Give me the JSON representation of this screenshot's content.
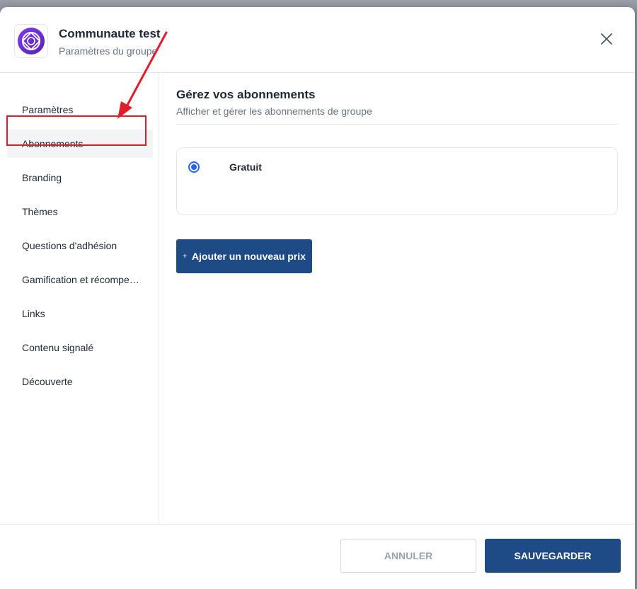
{
  "header": {
    "title": "Communaute test",
    "subtitle": "Paramètres du groupe"
  },
  "sidebar": {
    "items": [
      {
        "label": "Paramètres"
      },
      {
        "label": "Abonnements",
        "active": true
      },
      {
        "label": "Branding"
      },
      {
        "label": "Thèmes"
      },
      {
        "label": "Questions d'adhésion"
      },
      {
        "label": "Gamification et récompenses"
      },
      {
        "label": "Links"
      },
      {
        "label": "Contenu signalé"
      },
      {
        "label": "Découverte"
      }
    ]
  },
  "main": {
    "title": "Gérez vos abonnements",
    "subtitle": "Afficher et gérer les abonnements de groupe",
    "plans": [
      {
        "name": "Gratuit",
        "selected": true
      }
    ],
    "add_price_label": "Ajouter un nouveau prix"
  },
  "footer": {
    "cancel_label": "ANNULER",
    "save_label": "SAUVEGARDER"
  },
  "colors": {
    "primary": "#1e4a86",
    "radio": "#2563eb",
    "annotation": "#e11d2b",
    "logo": "#6d28d9"
  },
  "icons": {
    "logo": "circle-lattice-icon",
    "close": "close-icon",
    "radio": "radio-selected-icon",
    "add": "plus-icon"
  }
}
